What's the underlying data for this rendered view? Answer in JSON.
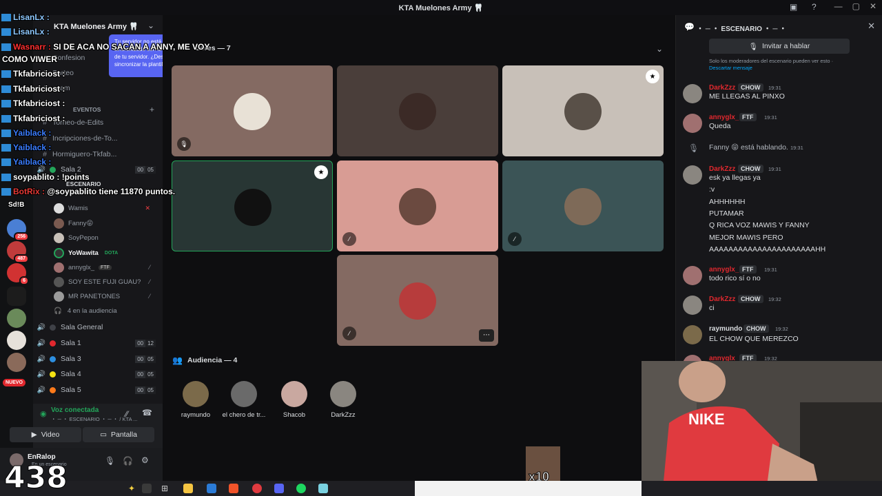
{
  "window": {
    "title": "KTA Muelones Army 🦷"
  },
  "server": {
    "name": "KTA Muelones Army 🦷"
  },
  "tooltip": {
    "text": "Tu servidor no está sincronizado con la plantilla de tu servidor. ¿Deseas sincronizar la plantilla?"
  },
  "rail": {
    "badges": [
      "256",
      "487",
      "6",
      "NUEVO"
    ]
  },
  "sidebar": {
    "channels": [
      {
        "label": "Confesion"
      },
      {
        "label": "Sorteo"
      },
      {
        "label": "spam"
      }
    ],
    "events_header": "EVENTOS",
    "event_channels": [
      {
        "label": "Torneo-de-Edits"
      },
      {
        "label": "Incripciones-de-To..."
      },
      {
        "label": "Hormiguero-Tkfab..."
      }
    ],
    "sala2": {
      "label": "Sala 2",
      "a": "00",
      "b": "05"
    },
    "stage_channel": "ESCENARIO",
    "members": [
      {
        "name": "Wamis"
      },
      {
        "name": "Fanny😝"
      },
      {
        "name": "SoyPepon"
      },
      {
        "name": "YoWawita",
        "tag": "DOTA"
      },
      {
        "name": "annyglx_",
        "tag": "FTF"
      },
      {
        "name": "SOY ESTE FUJI GUAU?"
      },
      {
        "name": "MR PANETONES"
      }
    ],
    "audience_count": "4 en la audiencia",
    "voice_channels": [
      {
        "label": "Sala General",
        "color": "#3f4147"
      },
      {
        "label": "Sala 1",
        "color": "#e0282e",
        "a": "00",
        "b": "12"
      },
      {
        "label": "Sala 3",
        "color": "#2d8fe0",
        "a": "00",
        "b": "05"
      },
      {
        "label": "Sala 4",
        "color": "#f5e113",
        "a": "00",
        "b": "05"
      },
      {
        "label": "Sala 5",
        "color": "#ff7a1a",
        "a": "00",
        "b": "05"
      }
    ]
  },
  "voice": {
    "status": "Voz conectada",
    "channel": "・ ─ ・ ESCENARIO ・ ─ ・ / KTA ...",
    "video_label": "Video",
    "screen_label": "Pantalla"
  },
  "user": {
    "name": "EnRalop",
    "status": "En un escenario"
  },
  "stage": {
    "speakers_header": "dores — 7",
    "audience_header": "Audiencia — 4",
    "audience": [
      {
        "name": "raymundo"
      },
      {
        "name": "el chero de tr..."
      },
      {
        "name": "Shacob"
      },
      {
        "name": "DarkZzz"
      }
    ],
    "more_label": "⋯"
  },
  "chat": {
    "header": "・ ─ ・ ESCENARIO ・ ─ ・",
    "invite_label": "Invitar a hablar",
    "moderators_note": "Solo los moderadores del escenario pueden ver esto ·",
    "dismiss_label": "Descartar mensaje",
    "messages": [
      {
        "name": "DarkZzz",
        "color": "#e0282e",
        "tag": "CHOW",
        "time": "19:31",
        "lines": [
          "ME LLEGAS AL PINXO"
        ]
      },
      {
        "name": "annyglx_",
        "color": "#e0282e",
        "tag": "FTF",
        "time": "19:31",
        "lines": [
          "Queda"
        ]
      },
      {
        "system": "Fanny 😝 está hablando.",
        "time": "19:31"
      },
      {
        "name": "DarkZzz",
        "color": "#e0282e",
        "tag": "CHOW",
        "time": "19:31",
        "lines": [
          "esk ya llegas ya",
          ":v",
          "AHHHHHH",
          "PUTAMAR",
          "Q RICA VOZ MAWIS Y FANNY",
          "MEJOR MAWIS PERO",
          "AAAAAAAAAAAAAAAAAAAAAAHH"
        ]
      },
      {
        "name": "annyglx_",
        "color": "#e0282e",
        "tag": "FTF",
        "time": "19:31",
        "lines": [
          "todo rico sí o no"
        ]
      },
      {
        "name": "DarkZzz",
        "color": "#e0282e",
        "tag": "CHOW",
        "time": "19:32",
        "lines": [
          "ci"
        ]
      },
      {
        "name": "raymundo",
        "color": "#dbdee1",
        "tag": "CHOW",
        "time": "19:32",
        "lines": [
          "EL CHOW QUE MEREZCO"
        ]
      },
      {
        "name": "annyglx_",
        "color": "#e0282e",
        "tag": "FTF",
        "time": "19:32",
        "lines": []
      }
    ]
  },
  "stream_overlay": {
    "chat": [
      {
        "user": "LisanLx",
        "text": "",
        "color": "#8ec8ff"
      },
      {
        "user": "LisanLx",
        "text": "",
        "color": "#8ec8ff"
      },
      {
        "user": "LisanLx",
        "text": "",
        "color": "#8ec8ff"
      },
      {
        "user": "Wasnarr",
        "text": "SI DE ACA NO SACAN A ANNY, ME VOY",
        "color": "#ff3030"
      },
      {
        "user": "",
        "text": "COMO VIWER",
        "color": "#ffffff"
      },
      {
        "user": "Tkfabriciost",
        "text": "",
        "color": "#ffffff"
      },
      {
        "user": "Tkfabriciost",
        "text": "",
        "color": "#ffffff"
      },
      {
        "user": "Tkfabriciost",
        "text": "",
        "color": "#ffffff"
      },
      {
        "user": "Tkfabriciost",
        "text": "",
        "color": "#ffffff"
      },
      {
        "user": "Yaiblack",
        "text": "",
        "color": "#3b7dff"
      },
      {
        "user": "Yaiblack",
        "text": "",
        "color": "#3b7dff"
      },
      {
        "user": "Yaiblack",
        "text": "",
        "color": "#3b7dff"
      },
      {
        "user": "soypablito",
        "text": "!points",
        "color": "#ffffff"
      },
      {
        "user": "BotRix",
        "text": "@soypablito tiene 11870 puntos.",
        "color": "#e53935"
      }
    ],
    "counter": "438",
    "multiplier": "x10",
    "sdb": "Sd!B"
  }
}
